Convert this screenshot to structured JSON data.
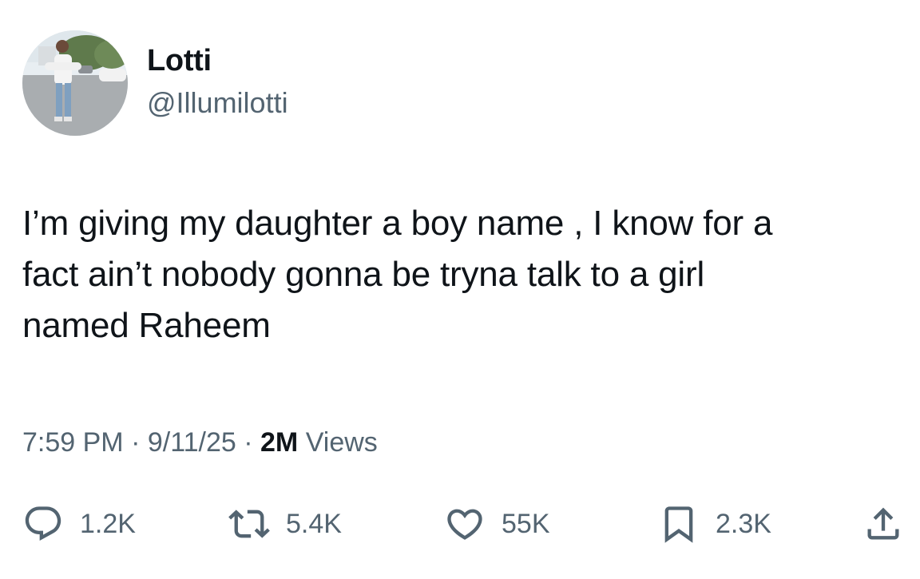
{
  "author": {
    "display_name": "Lotti",
    "handle": "@Illumilotti"
  },
  "tweet": {
    "text": "I’m giving my daughter a boy name , I know for a\nfact ain’t nobody gonna be tryna talk to a girl\nnamed Raheem"
  },
  "meta": {
    "time": "7:59 PM",
    "separator": "·",
    "date": "9/11/25",
    "views_count": "2M",
    "views_label": "Views"
  },
  "actions": {
    "reply": {
      "icon": "reply-icon",
      "count": "1.2K"
    },
    "retweet": {
      "icon": "retweet-icon",
      "count": "5.4K"
    },
    "like": {
      "icon": "heart-icon",
      "count": "55K"
    },
    "bookmark": {
      "icon": "bookmark-icon",
      "count": "2.3K"
    },
    "share": {
      "icon": "share-icon"
    }
  },
  "colors": {
    "text_primary": "#0f1419",
    "text_secondary": "#536471",
    "icon": "#536471"
  }
}
